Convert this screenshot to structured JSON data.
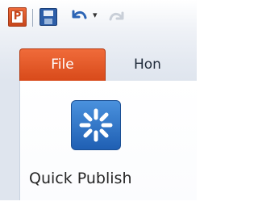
{
  "app": {
    "logo_letter": "P"
  },
  "quick_access_toolbar": {
    "save_icon": "save-icon",
    "undo_icon": "undo-icon",
    "undo_dropdown_icon": "chevron-down-icon",
    "redo_icon": "redo-icon"
  },
  "ribbon": {
    "tabs": [
      {
        "label": "File",
        "active": true
      },
      {
        "label": "Hon",
        "active": false
      }
    ]
  },
  "backstage": {
    "actions": [
      {
        "label": "Quick Publish",
        "icon": "quick-publish-icon"
      }
    ]
  },
  "colors": {
    "file_tab": "#e55a27",
    "publish_icon": "#2f74c8",
    "app_logo": "#d9532a"
  }
}
